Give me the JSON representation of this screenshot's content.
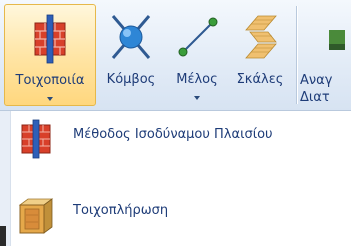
{
  "ribbon": {
    "buttons": [
      {
        "label": "Τοιχοποιία",
        "icon": "brick-wall-icon",
        "active": true,
        "has_dropdown": true
      },
      {
        "label": "Κόμβος",
        "icon": "node-icon",
        "active": false,
        "has_dropdown": false
      },
      {
        "label": "Μέλος",
        "icon": "member-line-icon",
        "active": false,
        "has_dropdown": true
      },
      {
        "label": "Σκάλες",
        "icon": "stairs-icon",
        "active": false,
        "has_dropdown": false
      }
    ],
    "partial_button": {
      "line1": "Αναγ",
      "line2": "Διατ",
      "icon": "partial-icon"
    }
  },
  "menu": {
    "items": [
      {
        "label": "Μέθοδος Ισοδύναμου Πλαισίου",
        "icon": "equivalent-frame-icon"
      },
      {
        "label": "Τοιχοπλήρωση",
        "icon": "infill-wall-icon"
      }
    ]
  },
  "colors": {
    "label_text": "#1e3c78",
    "active_fill": "#ffd77e",
    "ribbon_bg": "#e3ecf7",
    "brick": "#d8402a"
  }
}
